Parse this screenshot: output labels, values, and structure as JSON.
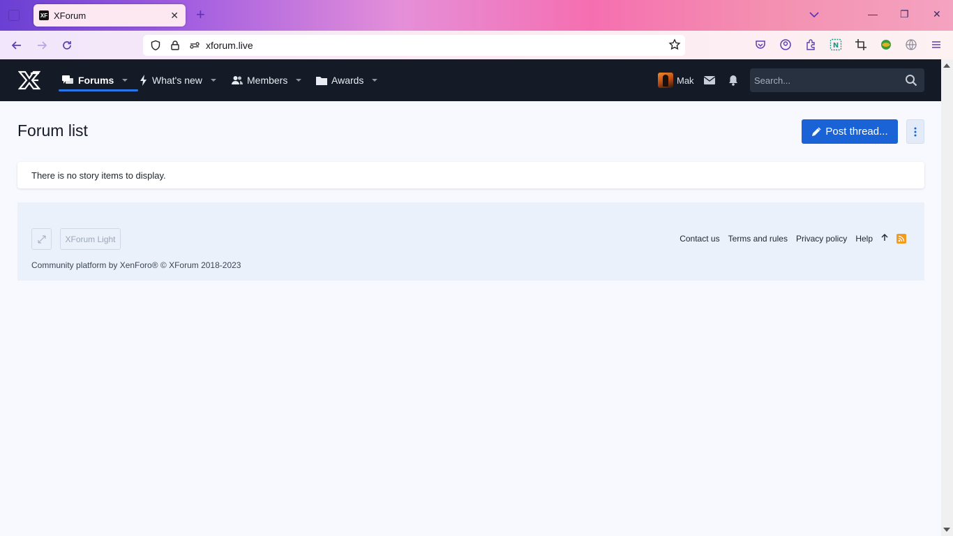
{
  "browser": {
    "tab_title": "XForum",
    "url": "xforum.live"
  },
  "header": {
    "nav": [
      {
        "label": "Forums"
      },
      {
        "label": "What's new"
      },
      {
        "label": "Members"
      },
      {
        "label": "Awards"
      }
    ],
    "user_name": "Mak",
    "search_placeholder": "Search..."
  },
  "main": {
    "page_title": "Forum list",
    "post_thread_label": "Post thread...",
    "notice": "There is no story items to display."
  },
  "footer": {
    "style_chooser": "XForum Light",
    "links": [
      "Contact us",
      "Terms and rules",
      "Privacy policy",
      "Help"
    ],
    "copyright": "Community platform by XenForo® © XForum 2018-2023"
  },
  "colors": {
    "header_bg": "#141b26",
    "accent": "#1a63d6",
    "page_bg": "#f7f9fe"
  }
}
